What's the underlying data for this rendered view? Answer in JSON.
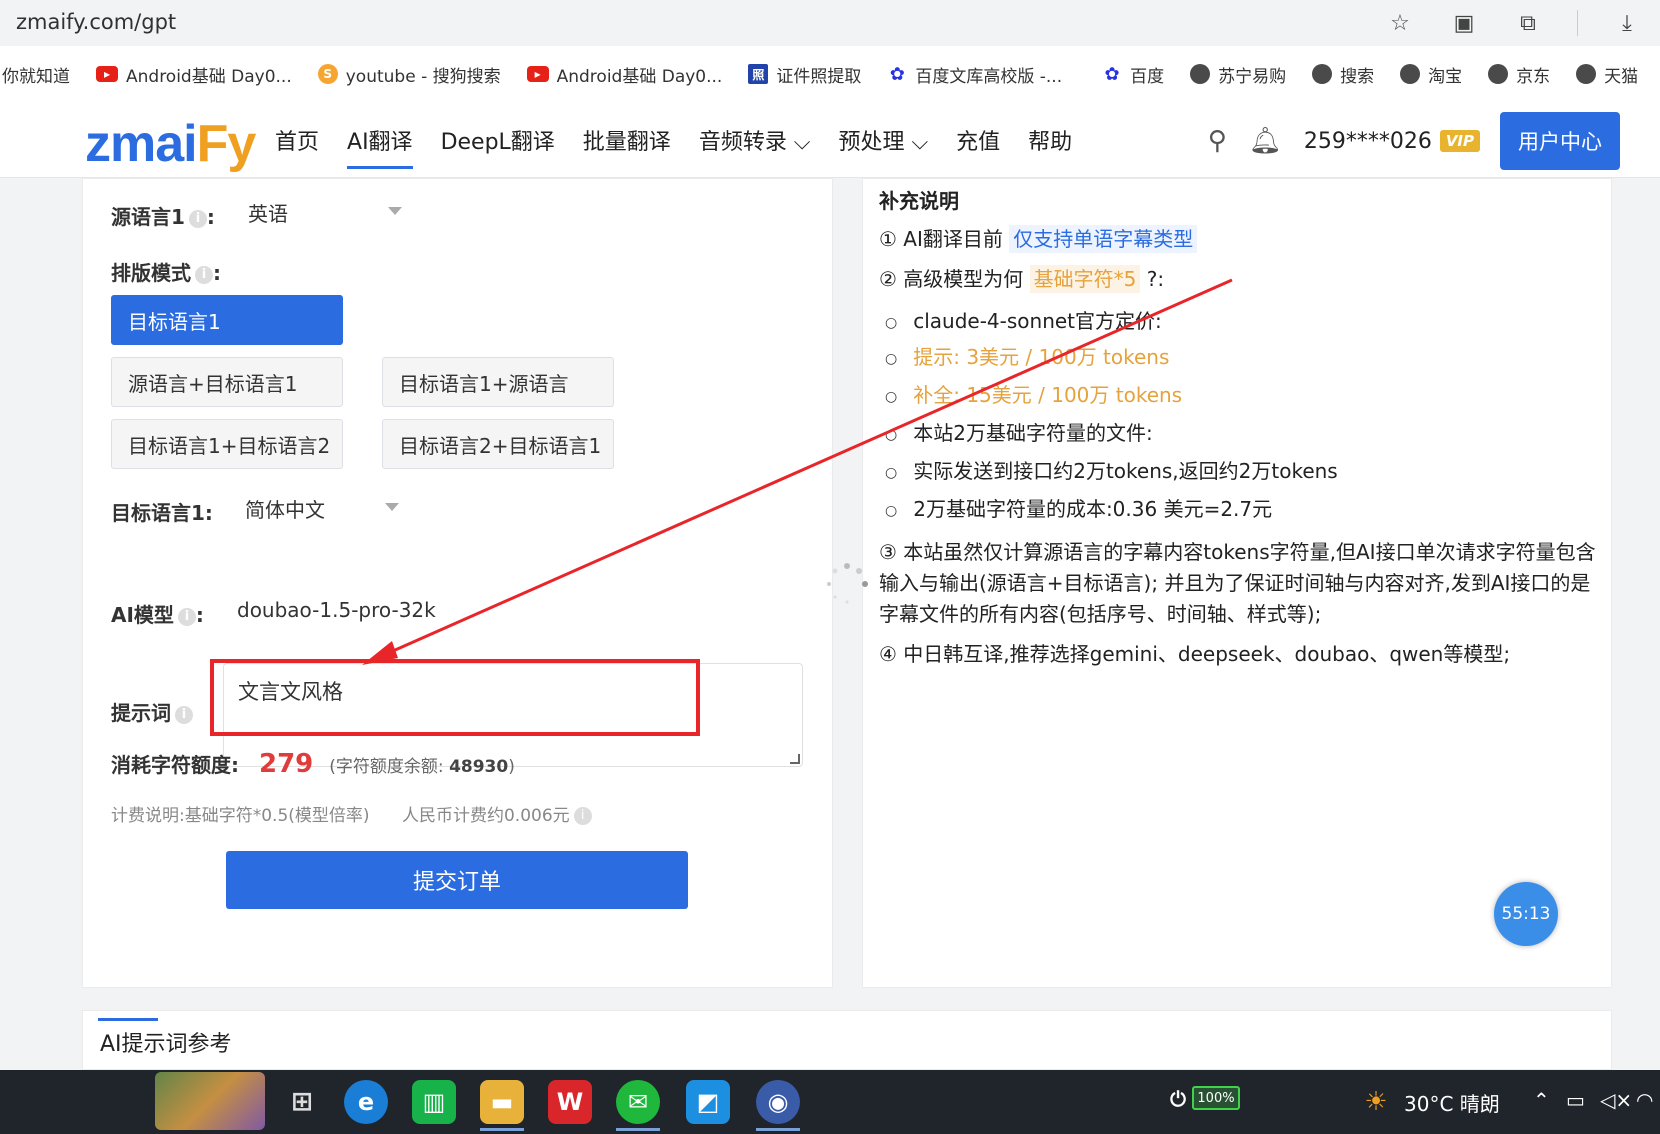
{
  "browser": {
    "url": "zmaify.com/gpt",
    "bookmarks": [
      {
        "label": "你就知道",
        "icon": "none"
      },
      {
        "label": "Android基础 Day0...",
        "icon": "youtube-icon"
      },
      {
        "label": "youtube - 搜狗搜索",
        "icon": "sogou-icon"
      },
      {
        "label": "Android基础 Day0...",
        "icon": "youtube-icon"
      },
      {
        "label": "证件照提取",
        "icon": "id-photo-icon"
      },
      {
        "label": "百度文库高校版 -...",
        "icon": "baidu-icon"
      },
      {
        "label": "百度",
        "icon": "baidu-icon"
      },
      {
        "label": "苏宁易购",
        "icon": "globe-icon"
      },
      {
        "label": "搜索",
        "icon": "globe-icon"
      },
      {
        "label": "淘宝",
        "icon": "globe-icon"
      },
      {
        "label": "京东",
        "icon": "globe-icon"
      },
      {
        "label": "天猫",
        "icon": "globe-icon"
      }
    ]
  },
  "header": {
    "logo_a": "zmai",
    "logo_b": "Fy",
    "nav": [
      "首页",
      "AI翻译",
      "DeepL翻译",
      "批量翻译",
      "音频转录 ⌵",
      "预处理 ⌵",
      "充值",
      "帮助"
    ],
    "active_nav": "AI翻译",
    "user": "259****026",
    "vip": "VIP",
    "user_center": "用户中心"
  },
  "form": {
    "source_lang_label": "源语言1",
    "source_lang_value": "英语",
    "layout_label": "排版模式",
    "layout_options": [
      "目标语言1",
      "源语言+目标语言1",
      "目标语言1+源语言",
      "目标语言1+目标语言2",
      "目标语言2+目标语言1"
    ],
    "target_lang_label": "目标语言1",
    "target_lang_value": "简体中文",
    "model_label": "AI模型",
    "model_value": "doubao-1.5-pro-32k",
    "prompt_label": "提示词",
    "prompt_value": "文言文风格",
    "cost_label": "消耗字符额度:",
    "cost_value": "279",
    "balance_text": "(字符额度余额:",
    "balance_value": "48930",
    "balance_close": ")",
    "billing_note": "计费说明:基础字符*0.5(模型倍率)",
    "rmb_note": "人民币计费约0.006元",
    "submit": "提交订单"
  },
  "supplement": {
    "title": "补充说明",
    "line1_prefix": "① AI翻译目前",
    "line1_highlight": "仅支持单语字幕类型",
    "line2_prefix": "② 高级模型为何",
    "line2_highlight": "基础字符*5",
    "line2_suffix": "?:",
    "bullets": [
      "claude-4-sonnet官方定价:",
      "提示: 3美元 / 100万 tokens",
      "补全: 15美元 / 100万 tokens",
      "本站2万基础字符量的文件:",
      "实际发送到接口约2万tokens,返回约2万tokens",
      "2万基础字符量的成本:0.36 美元=2.7元"
    ],
    "para3": "③ 本站虽然仅计算源语言的字幕内容tokens字符量,但AI接口单次请求字符量包含输入与输出(源语言+目标语言); 并且为了保证时间轴与内容对齐,发到AI接口的是字幕文件的所有内容(包括序号、时间轴、样式等);",
    "para4": "④ 中日韩互译,推荐选择gemini、deepseek、doubao、qwen等模型;"
  },
  "timer": "55:13",
  "reference_title": "AI提示词参考",
  "taskbar": {
    "battery": "100%",
    "weather": "30°C 晴朗"
  },
  "colors": {
    "brand_blue": "#2b6de0",
    "brand_orange": "#f0a020",
    "annotation_red": "#e8262a",
    "cost_red": "#e03c3c"
  }
}
